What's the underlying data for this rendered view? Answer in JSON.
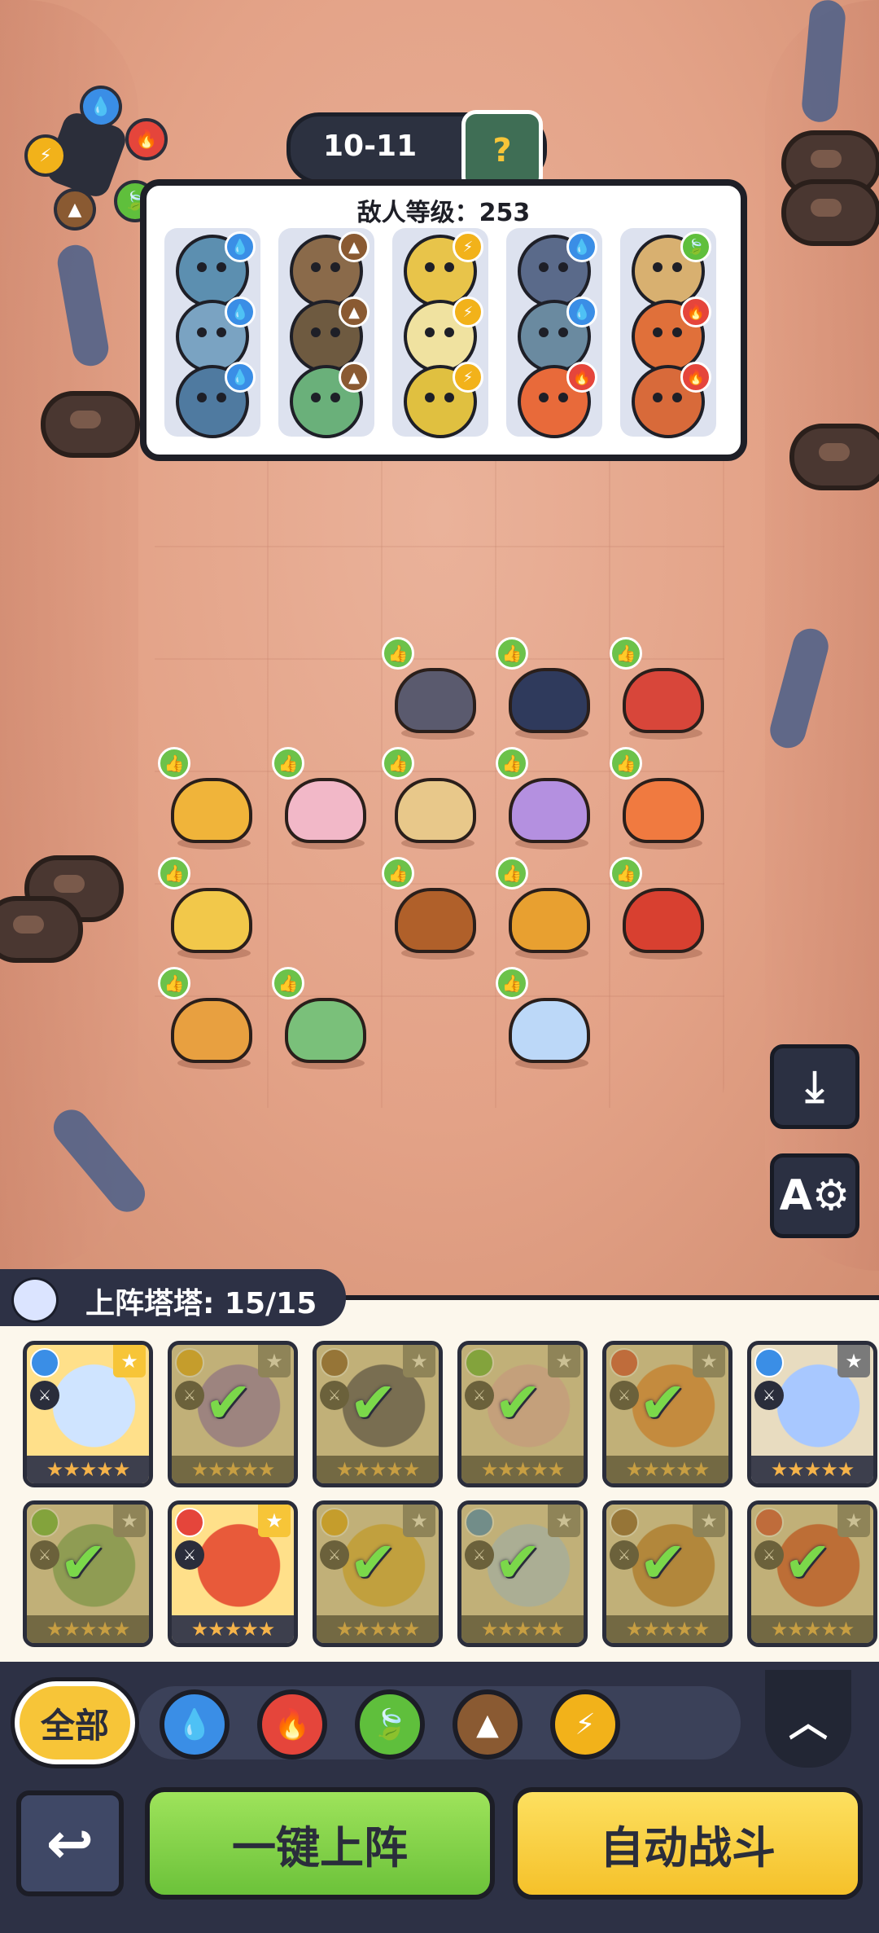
{
  "stage": {
    "label": "10-11",
    "boss_icon": "zombie-boss-icon"
  },
  "enemy_panel": {
    "title": "敌人等级：253",
    "columns": [
      {
        "enemies": [
          {
            "element": "water"
          },
          {
            "element": "water"
          },
          {
            "element": "water"
          }
        ]
      },
      {
        "enemies": [
          {
            "element": "earth"
          },
          {
            "element": "earth"
          },
          {
            "element": "earth"
          }
        ]
      },
      {
        "enemies": [
          {
            "element": "lightning"
          },
          {
            "element": "lightning"
          },
          {
            "element": "lightning"
          }
        ]
      },
      {
        "enemies": [
          {
            "element": "water"
          },
          {
            "element": "water"
          },
          {
            "element": "fire"
          }
        ]
      },
      {
        "enemies": [
          {
            "element": "grass"
          },
          {
            "element": "fire"
          },
          {
            "element": "fire"
          }
        ]
      }
    ]
  },
  "roster": {
    "title": "上阵塔塔: 15/15",
    "cards": [
      {
        "element": "water",
        "deployed": false,
        "stars": 5,
        "gold": true
      },
      {
        "element": "lightning",
        "deployed": true,
        "stars": 5,
        "gold": false
      },
      {
        "element": "earth",
        "deployed": true,
        "stars": 5,
        "gold": false
      },
      {
        "element": "grass",
        "deployed": true,
        "stars": 5,
        "gold": false
      },
      {
        "element": "fire",
        "deployed": true,
        "stars": 5,
        "gold": false
      },
      {
        "element": "water",
        "deployed": false,
        "stars": 5,
        "gold": false
      },
      {
        "element": "grass",
        "deployed": true,
        "stars": 5,
        "gold": false
      },
      {
        "element": "fire",
        "deployed": false,
        "stars": 5,
        "gold": true
      },
      {
        "element": "lightning",
        "deployed": true,
        "stars": 5,
        "gold": false
      },
      {
        "element": "water",
        "deployed": true,
        "stars": 5,
        "gold": false
      },
      {
        "element": "earth",
        "deployed": true,
        "stars": 5,
        "gold": false
      },
      {
        "element": "fire",
        "deployed": true,
        "stars": 5,
        "gold": false
      }
    ]
  },
  "filters": {
    "all_label": "全部",
    "elements": [
      "water",
      "fire",
      "grass",
      "earth",
      "lightning"
    ]
  },
  "actions": {
    "auto_deploy": "一键上阵",
    "auto_battle": "自动战斗"
  },
  "element_colors": {
    "water": "#3a8ee6",
    "fire": "#e5453b",
    "grass": "#5fbf3c",
    "earth": "#8a5a32",
    "lightning": "#f2b21a"
  },
  "element_glyphs": {
    "water": "💧",
    "fire": "🔥",
    "grass": "🍃",
    "earth": "▲",
    "lightning": "⚡"
  }
}
